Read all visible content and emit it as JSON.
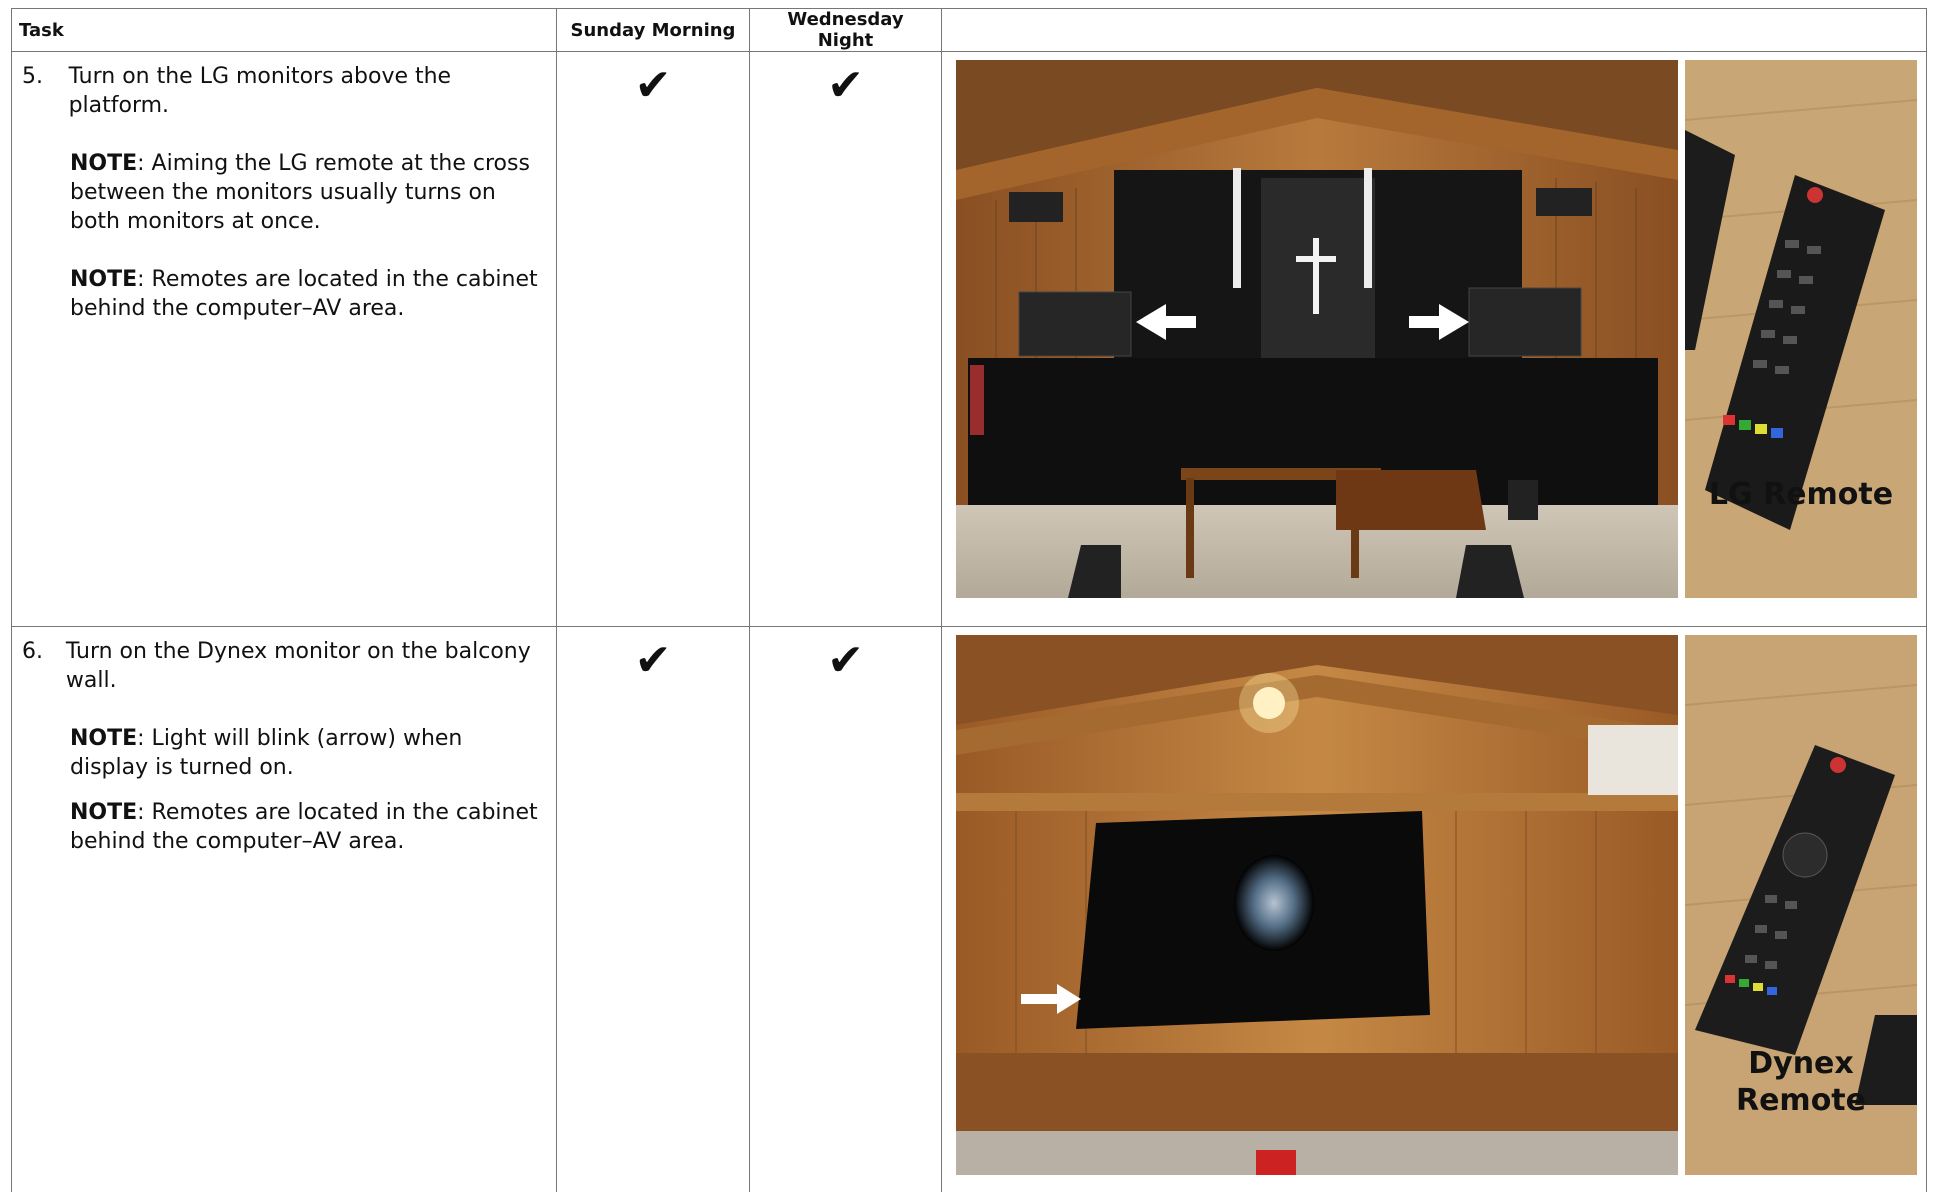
{
  "header": {
    "task": "Task",
    "sunday": "Sunday Morning",
    "wednesday": "Wednesday Night"
  },
  "rows": [
    {
      "number": "5.",
      "task": "Turn on the LG monitors above the platform.",
      "notes": [
        {
          "label": "NOTE",
          "text": ": Aiming the LG remote at the cross between the monitors usually turns on both monitors at once."
        },
        {
          "label": "NOTE",
          "text": ": Remotes are located in the cabinet behind the computer–AV area."
        }
      ],
      "sunday": "✔",
      "wednesday": "✔",
      "remote_caption": "LG Remote"
    },
    {
      "number": "6.",
      "task": "Turn on the Dynex monitor on the balcony wall.",
      "notes": [
        {
          "label": "NOTE",
          "text": ": Light will blink (arrow) when display is turned on."
        },
        {
          "label": "NOTE",
          "text": ": Remotes are located in the cabinet behind the computer–AV area."
        }
      ],
      "sunday": "✔",
      "wednesday": "✔",
      "remote_caption_line1": "Dynex",
      "remote_caption_line2": "Remote"
    }
  ]
}
